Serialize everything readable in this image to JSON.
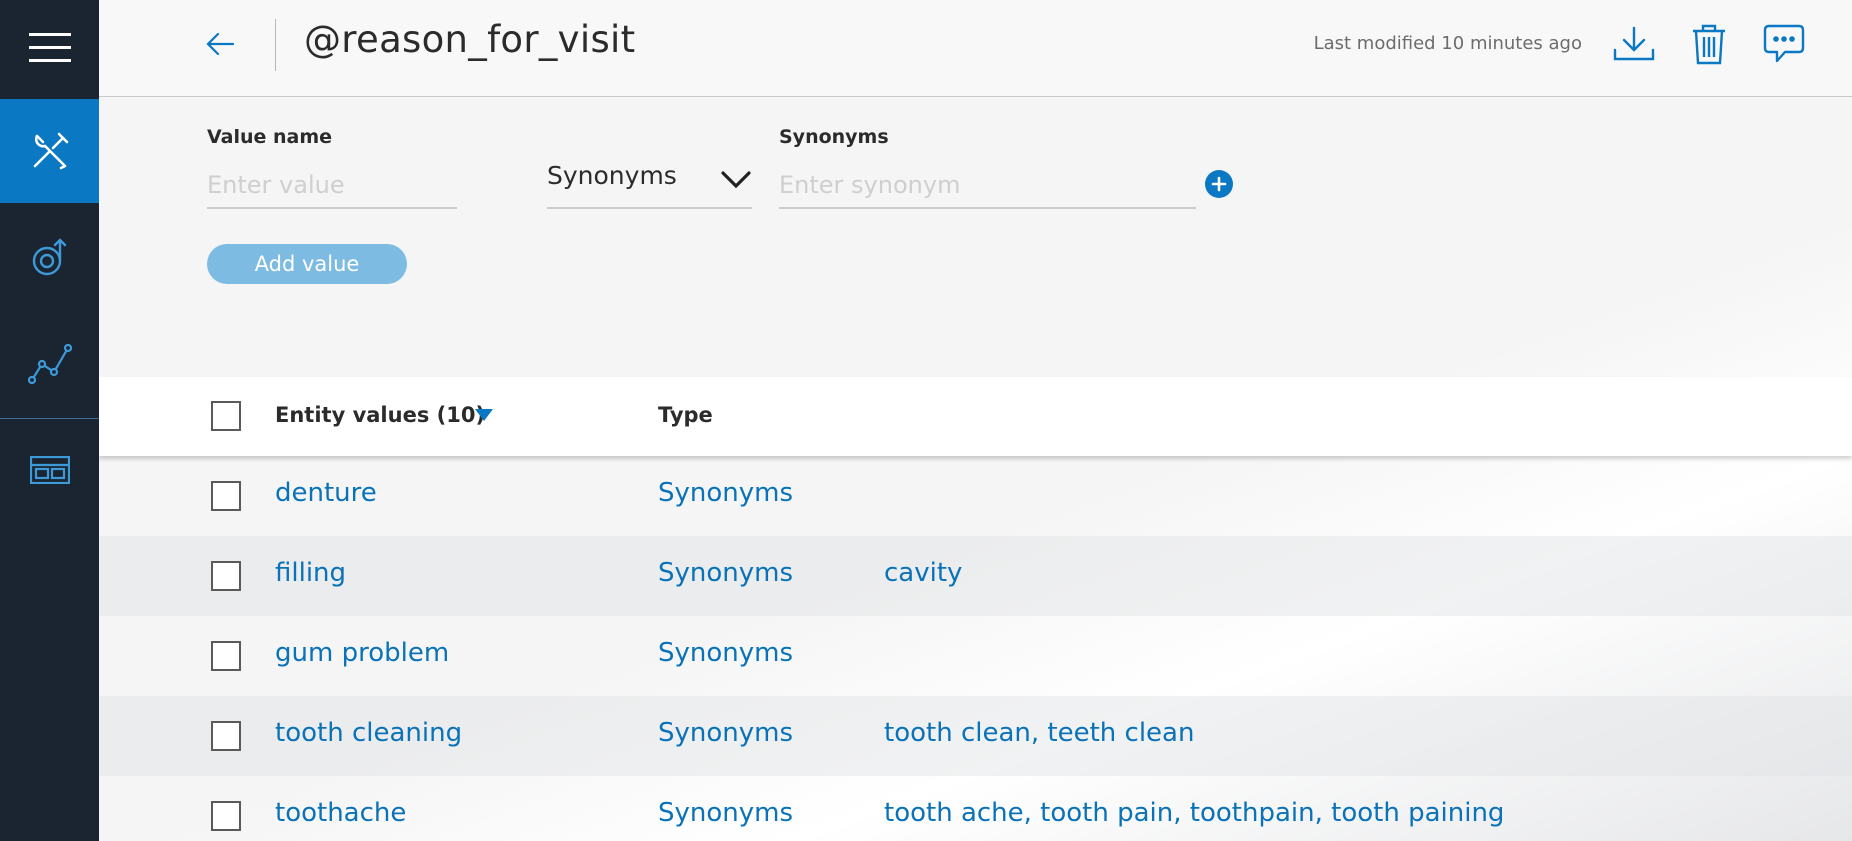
{
  "header": {
    "title": "@reason_for_visit",
    "last_modified": "Last modified 10 minutes ago"
  },
  "form": {
    "value_label": "Value name",
    "value_placeholder": "Enter value",
    "type_selected": "Synonyms",
    "synonyms_label": "Synonyms",
    "synonym_placeholder": "Enter synonym",
    "add_button": "Add value"
  },
  "table": {
    "header_values": "Entity values (10)",
    "header_type": "Type",
    "rows": [
      {
        "value": "denture",
        "type": "Synonyms",
        "synonyms": ""
      },
      {
        "value": "filling",
        "type": "Synonyms",
        "synonyms": "cavity"
      },
      {
        "value": "gum problem",
        "type": "Synonyms",
        "synonyms": ""
      },
      {
        "value": "tooth cleaning",
        "type": "Synonyms",
        "synonyms": "tooth clean, teeth clean"
      },
      {
        "value": "toothache",
        "type": "Synonyms",
        "synonyms": "tooth ache, tooth pain, toothpain, tooth paining"
      }
    ]
  },
  "icons": {
    "rail": [
      "hamburger-menu-icon",
      "tools-icon",
      "intent-icon",
      "analytics-icon",
      "content-catalog-icon"
    ],
    "header": [
      "back-arrow-icon",
      "download-icon",
      "trash-icon",
      "feedback-icon"
    ]
  },
  "colors": {
    "rail_bg": "#1b2532",
    "accent": "#0a78c2",
    "link": "#0a72b8",
    "button_disabled": "#7dbbe2"
  }
}
